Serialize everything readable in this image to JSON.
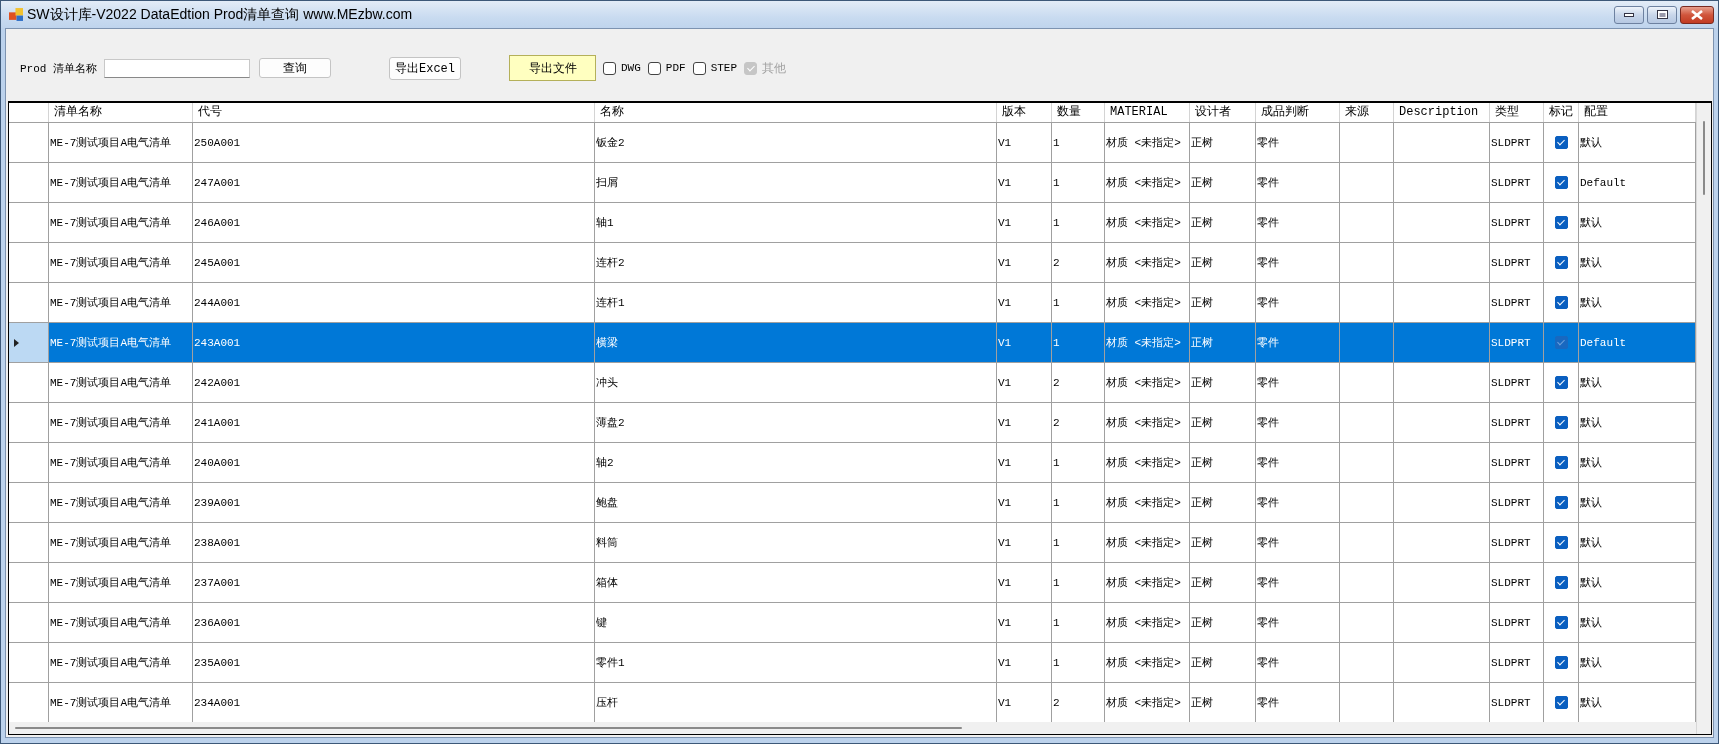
{
  "window": {
    "title": "SW设计库-V2022 DataEdtion Prod清单查询 www.MEzbw.com"
  },
  "toolbar": {
    "search_label": "Prod 清单名称",
    "query_button": "查询",
    "export_excel_button": "导出Excel",
    "export_file_button": "导出文件",
    "export_options": [
      {
        "label": "DWG",
        "checked": false,
        "disabled": false
      },
      {
        "label": "PDF",
        "checked": false,
        "disabled": false
      },
      {
        "label": "STEP",
        "checked": false,
        "disabled": false
      },
      {
        "label": "其他",
        "checked": true,
        "disabled": true
      }
    ]
  },
  "table": {
    "columns": [
      {
        "label": "清单名称",
        "kind": "text"
      },
      {
        "label": "代号",
        "kind": "text"
      },
      {
        "label": "名称",
        "kind": "text"
      },
      {
        "label": "版本",
        "kind": "text"
      },
      {
        "label": "数量",
        "kind": "text"
      },
      {
        "label": "MATERIAL",
        "kind": "text"
      },
      {
        "label": "设计者",
        "kind": "text"
      },
      {
        "label": "成品判断",
        "kind": "text"
      },
      {
        "label": "来源",
        "kind": "text"
      },
      {
        "label": "Description",
        "kind": "text"
      },
      {
        "label": "类型",
        "kind": "text"
      },
      {
        "label": "标记",
        "kind": "check"
      },
      {
        "label": "配置",
        "kind": "text"
      }
    ],
    "rows": [
      {
        "selected": false,
        "list_name": "ME-7测试项目A电气清单",
        "code": "250A001",
        "name": "钣金2",
        "version": "V1",
        "quantity": "1",
        "material": "材质 <未指定>",
        "designer": "正树",
        "judgment": "零件",
        "type": "SLDPRT",
        "marked": true,
        "config": "默认"
      },
      {
        "selected": false,
        "list_name": "ME-7测试项目A电气清单",
        "code": "247A001",
        "name": "扫屑",
        "version": "V1",
        "quantity": "1",
        "material": "材质 <未指定>",
        "designer": "正树",
        "judgment": "零件",
        "type": "SLDPRT",
        "marked": true,
        "config": "Default"
      },
      {
        "selected": false,
        "list_name": "ME-7测试项目A电气清单",
        "code": "246A001",
        "name": "轴1",
        "version": "V1",
        "quantity": "1",
        "material": "材质 <未指定>",
        "designer": "正树",
        "judgment": "零件",
        "type": "SLDPRT",
        "marked": true,
        "config": "默认"
      },
      {
        "selected": false,
        "list_name": "ME-7测试项目A电气清单",
        "code": "245A001",
        "name": "连杆2",
        "version": "V1",
        "quantity": "2",
        "material": "材质 <未指定>",
        "designer": "正树",
        "judgment": "零件",
        "type": "SLDPRT",
        "marked": true,
        "config": "默认"
      },
      {
        "selected": false,
        "list_name": "ME-7测试项目A电气清单",
        "code": "244A001",
        "name": "连杆1",
        "version": "V1",
        "quantity": "1",
        "material": "材质 <未指定>",
        "designer": "正树",
        "judgment": "零件",
        "type": "SLDPRT",
        "marked": true,
        "config": "默认"
      },
      {
        "selected": true,
        "list_name": "ME-7测试项目A电气清单",
        "code": "243A001",
        "name": "横梁",
        "version": "V1",
        "quantity": "1",
        "material": "材质 <未指定>",
        "designer": "正树",
        "judgment": "零件",
        "type": "SLDPRT",
        "marked": true,
        "config": "Default"
      },
      {
        "selected": false,
        "list_name": "ME-7测试项目A电气清单",
        "code": "242A001",
        "name": "冲头",
        "version": "V1",
        "quantity": "2",
        "material": "材质 <未指定>",
        "designer": "正树",
        "judgment": "零件",
        "type": "SLDPRT",
        "marked": true,
        "config": "默认"
      },
      {
        "selected": false,
        "list_name": "ME-7测试项目A电气清单",
        "code": "241A001",
        "name": "薄盘2",
        "version": "V1",
        "quantity": "2",
        "material": "材质 <未指定>",
        "designer": "正树",
        "judgment": "零件",
        "type": "SLDPRT",
        "marked": true,
        "config": "默认"
      },
      {
        "selected": false,
        "list_name": "ME-7测试项目A电气清单",
        "code": "240A001",
        "name": "轴2",
        "version": "V1",
        "quantity": "1",
        "material": "材质 <未指定>",
        "designer": "正树",
        "judgment": "零件",
        "type": "SLDPRT",
        "marked": true,
        "config": "默认"
      },
      {
        "selected": false,
        "list_name": "ME-7测试项目A电气清单",
        "code": "239A001",
        "name": "鲍盘",
        "version": "V1",
        "quantity": "1",
        "material": "材质 <未指定>",
        "designer": "正树",
        "judgment": "零件",
        "type": "SLDPRT",
        "marked": true,
        "config": "默认"
      },
      {
        "selected": false,
        "list_name": "ME-7测试项目A电气清单",
        "code": "238A001",
        "name": "料筒",
        "version": "V1",
        "quantity": "1",
        "material": "材质 <未指定>",
        "designer": "正树",
        "judgment": "零件",
        "type": "SLDPRT",
        "marked": true,
        "config": "默认"
      },
      {
        "selected": false,
        "list_name": "ME-7测试项目A电气清单",
        "code": "237A001",
        "name": "箱体",
        "version": "V1",
        "quantity": "1",
        "material": "材质 <未指定>",
        "designer": "正树",
        "judgment": "零件",
        "type": "SLDPRT",
        "marked": true,
        "config": "默认"
      },
      {
        "selected": false,
        "list_name": "ME-7测试项目A电气清单",
        "code": "236A001",
        "name": "键",
        "version": "V1",
        "quantity": "1",
        "material": "材质 <未指定>",
        "designer": "正树",
        "judgment": "零件",
        "type": "SLDPRT",
        "marked": true,
        "config": "默认"
      },
      {
        "selected": false,
        "list_name": "ME-7测试项目A电气清单",
        "code": "235A001",
        "name": "零件1",
        "version": "V1",
        "quantity": "1",
        "material": "材质 <未指定>",
        "designer": "正树",
        "judgment": "零件",
        "type": "SLDPRT",
        "marked": true,
        "config": "默认"
      },
      {
        "selected": false,
        "list_name": "ME-7测试项目A电气清单",
        "code": "234A001",
        "name": "压杆",
        "version": "V1",
        "quantity": "2",
        "material": "材质 <未指定>",
        "designer": "正树",
        "judgment": "零件",
        "type": "SLDPRT",
        "marked": true,
        "config": "默认"
      }
    ]
  }
}
